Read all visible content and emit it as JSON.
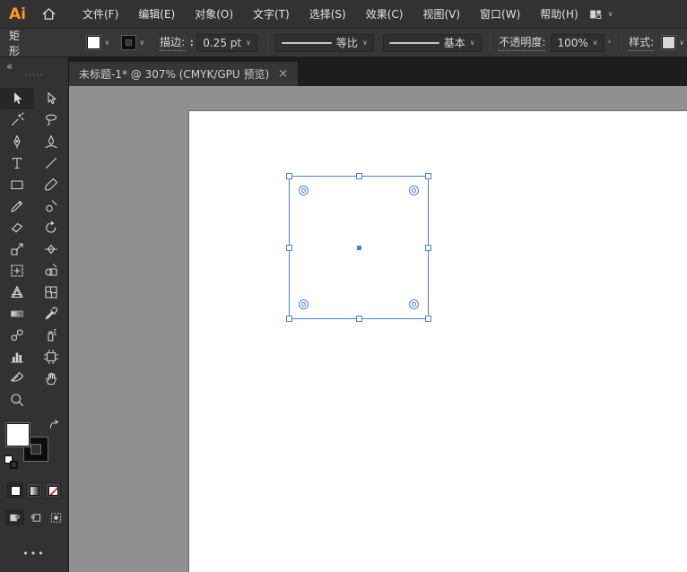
{
  "app": {
    "logo_text": "Ai"
  },
  "glyphs": {
    "chevron": "∨",
    "chevron_right": "›",
    "close": "×",
    "collapse": "«",
    "step_up": "▴",
    "step_down": "▾",
    "more": "•••",
    "grip": "·····"
  },
  "menubar": {
    "items": [
      "文件(F)",
      "编辑(E)",
      "对象(O)",
      "文字(T)",
      "选择(S)",
      "效果(C)",
      "视图(V)",
      "窗口(W)",
      "帮助(H)"
    ]
  },
  "control_bar": {
    "context_label": "矩形",
    "stroke_label": "描边:",
    "stroke_weight": "0.25 pt",
    "profile_value": "等比",
    "brush_value": "基本",
    "opacity_label": "不透明度:",
    "opacity_value": "100%",
    "style_label": "样式:"
  },
  "tab": {
    "title": "未标题-1* @ 307% (CMYK/GPU 预览)"
  },
  "toolbar": {
    "tools": [
      {
        "name": "selection-tool",
        "active": true
      },
      {
        "name": "direct-selection-tool"
      },
      {
        "name": "magic-wand-tool"
      },
      {
        "name": "lasso-tool"
      },
      {
        "name": "pen-tool"
      },
      {
        "name": "curvature-tool"
      },
      {
        "name": "type-tool"
      },
      {
        "name": "line-segment-tool"
      },
      {
        "name": "rectangle-tool"
      },
      {
        "name": "paintbrush-tool"
      },
      {
        "name": "shaper-tool"
      },
      {
        "name": "blob-brush-tool"
      },
      {
        "name": "eraser-tool"
      },
      {
        "name": "rotate-tool"
      },
      {
        "name": "scale-tool"
      },
      {
        "name": "width-tool"
      },
      {
        "name": "free-transform-tool"
      },
      {
        "name": "shape-builder-tool"
      },
      {
        "name": "perspective-grid-tool"
      },
      {
        "name": "mesh-tool"
      },
      {
        "name": "gradient-tool"
      },
      {
        "name": "eyedropper-tool"
      },
      {
        "name": "blend-tool"
      },
      {
        "name": "symbol-sprayer-tool"
      },
      {
        "name": "column-graph-tool"
      },
      {
        "name": "artboard-tool"
      },
      {
        "name": "slice-tool"
      },
      {
        "name": "hand-tool"
      },
      {
        "name": "zoom-tool"
      }
    ]
  },
  "colors": {
    "selection_blue": "#4a80d8",
    "ui_dark": "#323232",
    "pasteboard_gray": "#909090",
    "artboard_white": "#ffffff",
    "logo_orange": "#ff9a1e"
  }
}
